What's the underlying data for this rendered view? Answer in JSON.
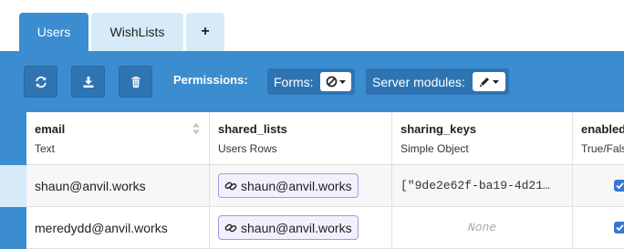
{
  "tabs": [
    {
      "label": "Users",
      "active": true
    },
    {
      "label": "WishLists",
      "active": false
    },
    {
      "label": "+",
      "active": false
    }
  ],
  "toolbar": {
    "buttons": [
      "refresh-icon",
      "download-icon",
      "trash-icon"
    ],
    "permissions_label": "Permissions:",
    "forms_label": "Forms:",
    "forms_value_icon": "no-access-icon",
    "server_label": "Server modules:",
    "server_value_icon": "pencil-icon"
  },
  "columns": [
    {
      "name": "email",
      "type": "Text",
      "sortable": true
    },
    {
      "name": "shared_lists",
      "type": "Users Rows"
    },
    {
      "name": "sharing_keys",
      "type": "Simple Object"
    },
    {
      "name": "enabled",
      "type": "True/False"
    }
  ],
  "rows": [
    {
      "email": "shaun@anvil.works",
      "shared_lists": "shaun@anvil.works",
      "sharing_keys": "[\"9de2e62f-ba19-4d21…",
      "enabled": true
    },
    {
      "email": "meredydd@anvil.works",
      "shared_lists": "shaun@anvil.works",
      "sharing_keys": "None",
      "enabled": true
    }
  ],
  "colors": {
    "accent": "#3b8dd0",
    "tab_inactive": "#d6ebf7",
    "chip_border": "#9c9cdc",
    "checkbox": "#3478d6"
  }
}
